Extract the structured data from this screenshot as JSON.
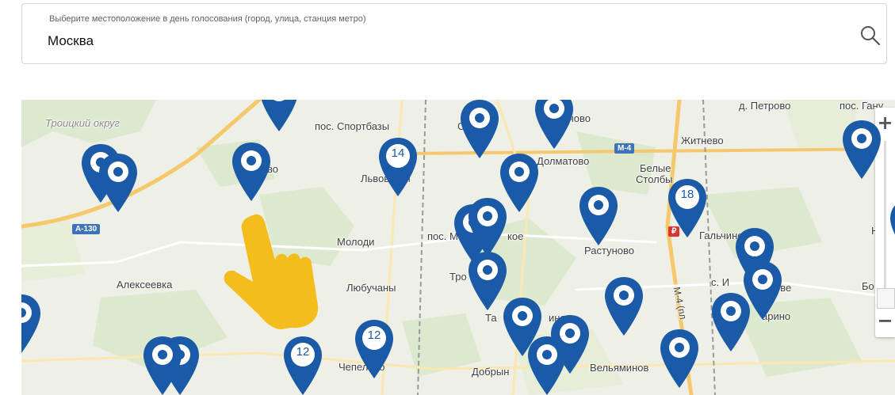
{
  "search": {
    "hint": "Выберите местоположение в день голосования (город, улица, станция метро)",
    "value": "Москва",
    "icon": "search-icon"
  },
  "map": {
    "places": [
      {
        "text": "Троицкий округ",
        "style": "district"
      },
      {
        "text": "пос. Спортбазы"
      },
      {
        "text": "д. Петрово"
      },
      {
        "text": "пос. Гану"
      },
      {
        "text": "Житнево"
      },
      {
        "text": "Долматово"
      },
      {
        "text": "Белые"
      },
      {
        "text": "Столбы"
      },
      {
        "text": "Львовский"
      },
      {
        "text": "Молоди"
      },
      {
        "text": "пос. М"
      },
      {
        "text": "кое"
      },
      {
        "text": "Растуново"
      },
      {
        "text": "Гальчино"
      },
      {
        "text": "Ни"
      },
      {
        "text": "Алексеевка"
      },
      {
        "text": "Любучаны"
      },
      {
        "text": "Тро"
      },
      {
        "text": "с. И"
      },
      {
        "text": "Та"
      },
      {
        "text": "ино"
      },
      {
        "text": "Чепелёво"
      },
      {
        "text": "Добрын"
      },
      {
        "text": "Вельяминов"
      },
      {
        "text": "арино"
      },
      {
        "text": "Бо"
      },
      {
        "text": "ове"
      },
      {
        "text": "чово"
      },
      {
        "text": "MC"
      },
      {
        "text": "во"
      },
      {
        "text": "С"
      }
    ],
    "roads": [
      "A-130",
      "M-4",
      "M-4 (пл"
    ],
    "ruble_sign": "₽",
    "pins": [
      {
        "label": ""
      },
      {
        "label": ""
      },
      {
        "label": ""
      },
      {
        "label": ""
      },
      {
        "label": ""
      },
      {
        "label": "14"
      },
      {
        "label": ""
      },
      {
        "label": ""
      },
      {
        "label": ""
      },
      {
        "label": ""
      },
      {
        "label": "18"
      },
      {
        "label": ""
      },
      {
        "label": ""
      },
      {
        "label": ""
      },
      {
        "label": ""
      },
      {
        "label": ""
      },
      {
        "label": ""
      },
      {
        "label": ""
      },
      {
        "label": "12"
      },
      {
        "label": "12"
      },
      {
        "label": ""
      },
      {
        "label": ""
      },
      {
        "label": ""
      },
      {
        "label": ""
      },
      {
        "label": ""
      },
      {
        "label": ""
      },
      {
        "label": ""
      },
      {
        "label": ""
      }
    ],
    "pin_color": "#1b5aa6",
    "hand_color": "#f3bd1b",
    "zoom": {
      "plus": "+",
      "minus": "−"
    }
  }
}
